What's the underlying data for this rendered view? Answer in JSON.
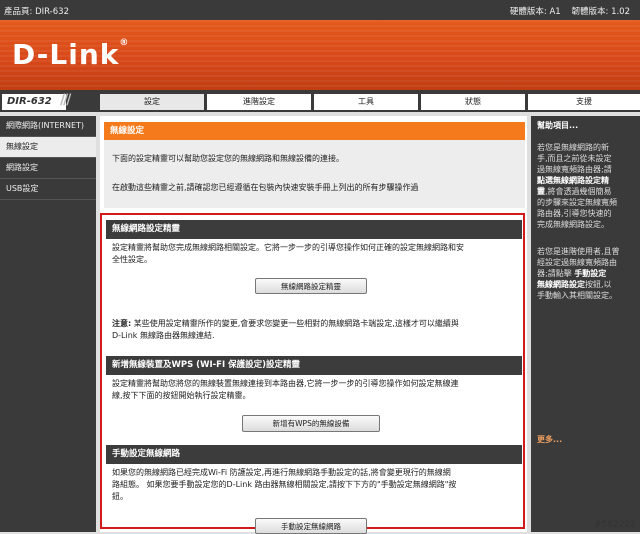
{
  "header": {
    "product_page": "產品頁: DIR-632",
    "versions": "硬體版本: A1    韌體版本: 1.02",
    "logo": "D-Link"
  },
  "model_badge": "DIR-632",
  "tabs": [
    {
      "label": "設定"
    },
    {
      "label": "進階設定"
    },
    {
      "label": "工具"
    },
    {
      "label": "狀態"
    },
    {
      "label": "支援"
    }
  ],
  "sidebar": {
    "items": [
      {
        "label": "網際網路(INTERNET)"
      },
      {
        "label": "無線設定"
      },
      {
        "label": "網路設定"
      },
      {
        "label": "USB設定"
      }
    ]
  },
  "main": {
    "title": "無線設定",
    "intro_1": "下面的設定精靈可以幫助您設定您的無線網路和無線設備的連接。",
    "intro_2": "在啟動這些精靈之前,請確認您已經遵循在包裝內快速安裝手冊上列出的所有步驟操作過",
    "section1": {
      "title": "無線網路設定精靈",
      "text_1": "設定精靈將幫助您完成無線網路相關設定。它將一步一步的引導您操作如何正確的設定無線網路和安",
      "text_2": "全性設定。",
      "button": "無線網路設定精靈",
      "note_label": "注意:",
      "note_1": " 某些使用設定精靈所作的變更,會要求您變更一些相對的無線網路卡端設定,這樣才可以繼續與",
      "note_2": "D-Link 無線路由器無線連結."
    },
    "section2": {
      "title": "新增無線裝置及WPS (WI-FI 保護設定)設定精靈",
      "text_1": "設定精靈將幫助您將您的無線裝置無線連接到本路由器,它將一步一步的引導您操作如何設定無線連",
      "text_2": "線,按下下面的按鈕開始執行設定精靈。",
      "button": "新增有WPS的無線設備"
    },
    "section3": {
      "title": "手動設定無線網路",
      "text_1": "如果您的無線網路已經完成Wi-Fi 防護設定,再進行無線網路手動設定的話,將會變更現行的無線網",
      "text_2": "路組態。 如果您要手動設定您的D-Link 路由器無線相關設定,請按下下方的\"手動設定無線網路\"按",
      "text_3": "鈕。",
      "button": "手動設定無線網路"
    }
  },
  "help": {
    "title": "幫助項目...",
    "p1_lines": [
      "若您是無線網路的新",
      "手,而且之前從未設定",
      "過無線寬頻路由器;請"
    ],
    "p1_bold_a": "點選無線網路設定精",
    "p1_bold_b": "靈",
    "p1_rest": ",將會透過幾個簡易",
    "p1_lines_b": [
      "的步驟來設定無線寬頻",
      "路由器,引導您快速的",
      "完成無線網路設定。"
    ],
    "p2_lines": [
      "若您是進階使用者,且曾",
      "經設定過無線寬頻路由",
      "器;請點擊 "
    ],
    "p2_bold_a": "手動設定",
    "p2_bold_b": "無線網路設定",
    "p2_rest": "按鈕,以",
    "p2_last": "手動輸入其相關設定。",
    "more": "更多..."
  },
  "watermark": "#582222",
  "colors": {
    "accent_orange": "#f57a1c",
    "banner_orange": "#d8481a",
    "highlight_red": "#d11a1a",
    "dark_bar": "#3a3a3a"
  }
}
